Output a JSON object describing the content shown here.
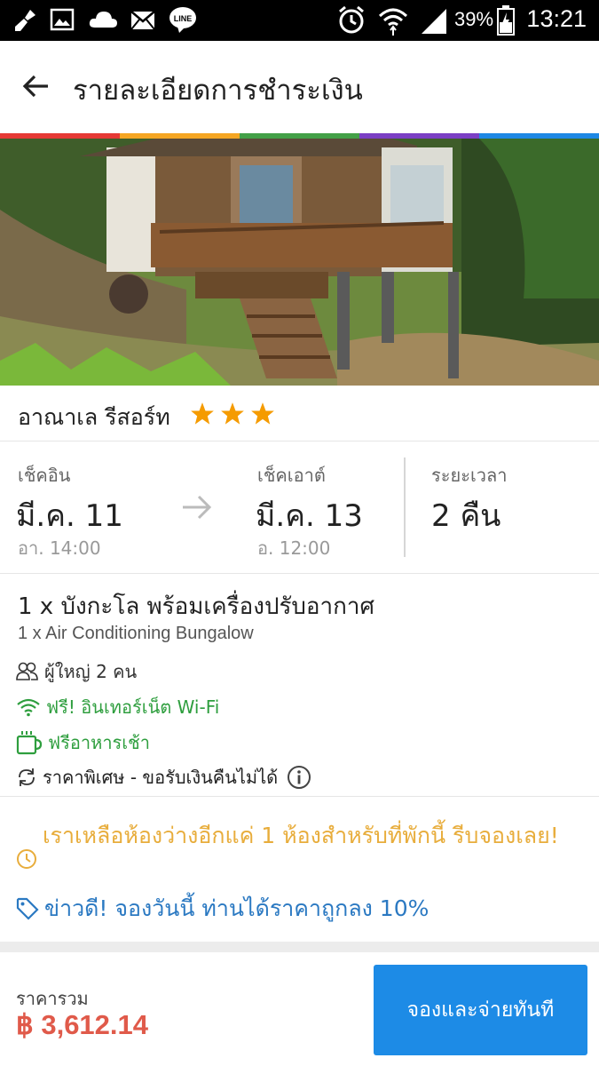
{
  "status_bar": {
    "battery": "39%",
    "time": "13:21",
    "line_app": "LINE"
  },
  "header": {
    "title": "รายละเอียดการชำระเงิน"
  },
  "accent_colors": [
    "#e53935",
    "#f5a623",
    "#43a047",
    "#7b3fc4",
    "#1e88e5"
  ],
  "hotel": {
    "name": "อาณาเล รีสอร์ท",
    "stars": 3
  },
  "stay": {
    "checkin_label": "เช็คอิน",
    "checkin_date": "มี.ค. 11",
    "checkin_time": "อา. 14:00",
    "checkout_label": "เช็คเอาต์",
    "checkout_date": "มี.ค. 13",
    "checkout_time": "อ. 12:00",
    "duration_label": "ระยะเวลา",
    "duration_value": "2 คืน"
  },
  "room": {
    "name_th": "1 x บังกะโล พร้อมเครื่องปรับอากาศ",
    "name_en": "1 x Air Conditioning Bungalow",
    "guests": "ผู้ใหญ่ 2 คน",
    "wifi": "ฟรี! อินเทอร์เน็ต Wi-Fi",
    "breakfast": "ฟรีอาหารเช้า",
    "policy": "ราคาพิเศษ - ขอรับเงินคืนไม่ได้"
  },
  "notices": {
    "availability": "เราเหลือห้องว่างอีกแค่ 1 ห้องสำหรับที่พักนี้ รีบจองเลย!",
    "deal": "ข่าวดี! จองวันนี้ ท่านได้ราคาถูกลง 10%"
  },
  "footer": {
    "total_label": "ราคารวม",
    "total_value": "฿ 3,612.14",
    "book_button": "จองและจ่ายทันที"
  }
}
